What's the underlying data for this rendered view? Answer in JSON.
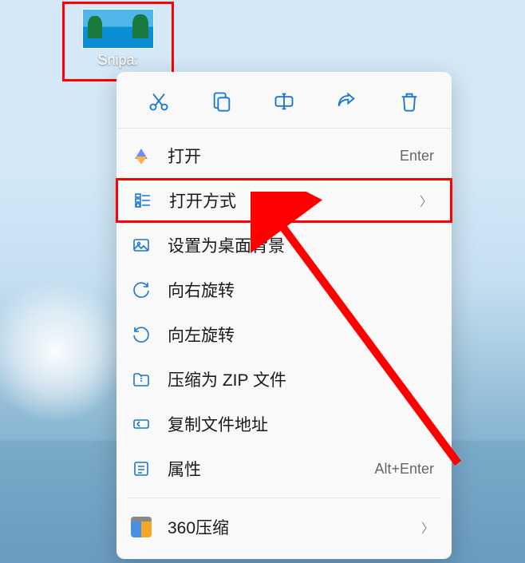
{
  "desktop": {
    "icon_label": "Snipa:"
  },
  "action_bar": {
    "cut": "cut",
    "copy": "copy",
    "rename": "rename",
    "share": "share",
    "delete": "delete"
  },
  "menu": {
    "open": {
      "label": "打开",
      "shortcut": "Enter"
    },
    "open_with": {
      "label": "打开方式",
      "has_submenu": true
    },
    "set_wallpaper": {
      "label": "设置为桌面背景"
    },
    "rotate_right": {
      "label": "向右旋转"
    },
    "rotate_left": {
      "label": "向左旋转"
    },
    "compress_zip": {
      "label": "压缩为 ZIP 文件"
    },
    "copy_path": {
      "label": "复制文件地址"
    },
    "properties": {
      "label": "属性",
      "shortcut": "Alt+Enter"
    },
    "zip360": {
      "label": "360压缩",
      "has_submenu": true
    }
  },
  "annotations": {
    "file_highlight": "red-box",
    "menu_highlight": "red-box-open-with",
    "arrow": "red-arrow"
  }
}
